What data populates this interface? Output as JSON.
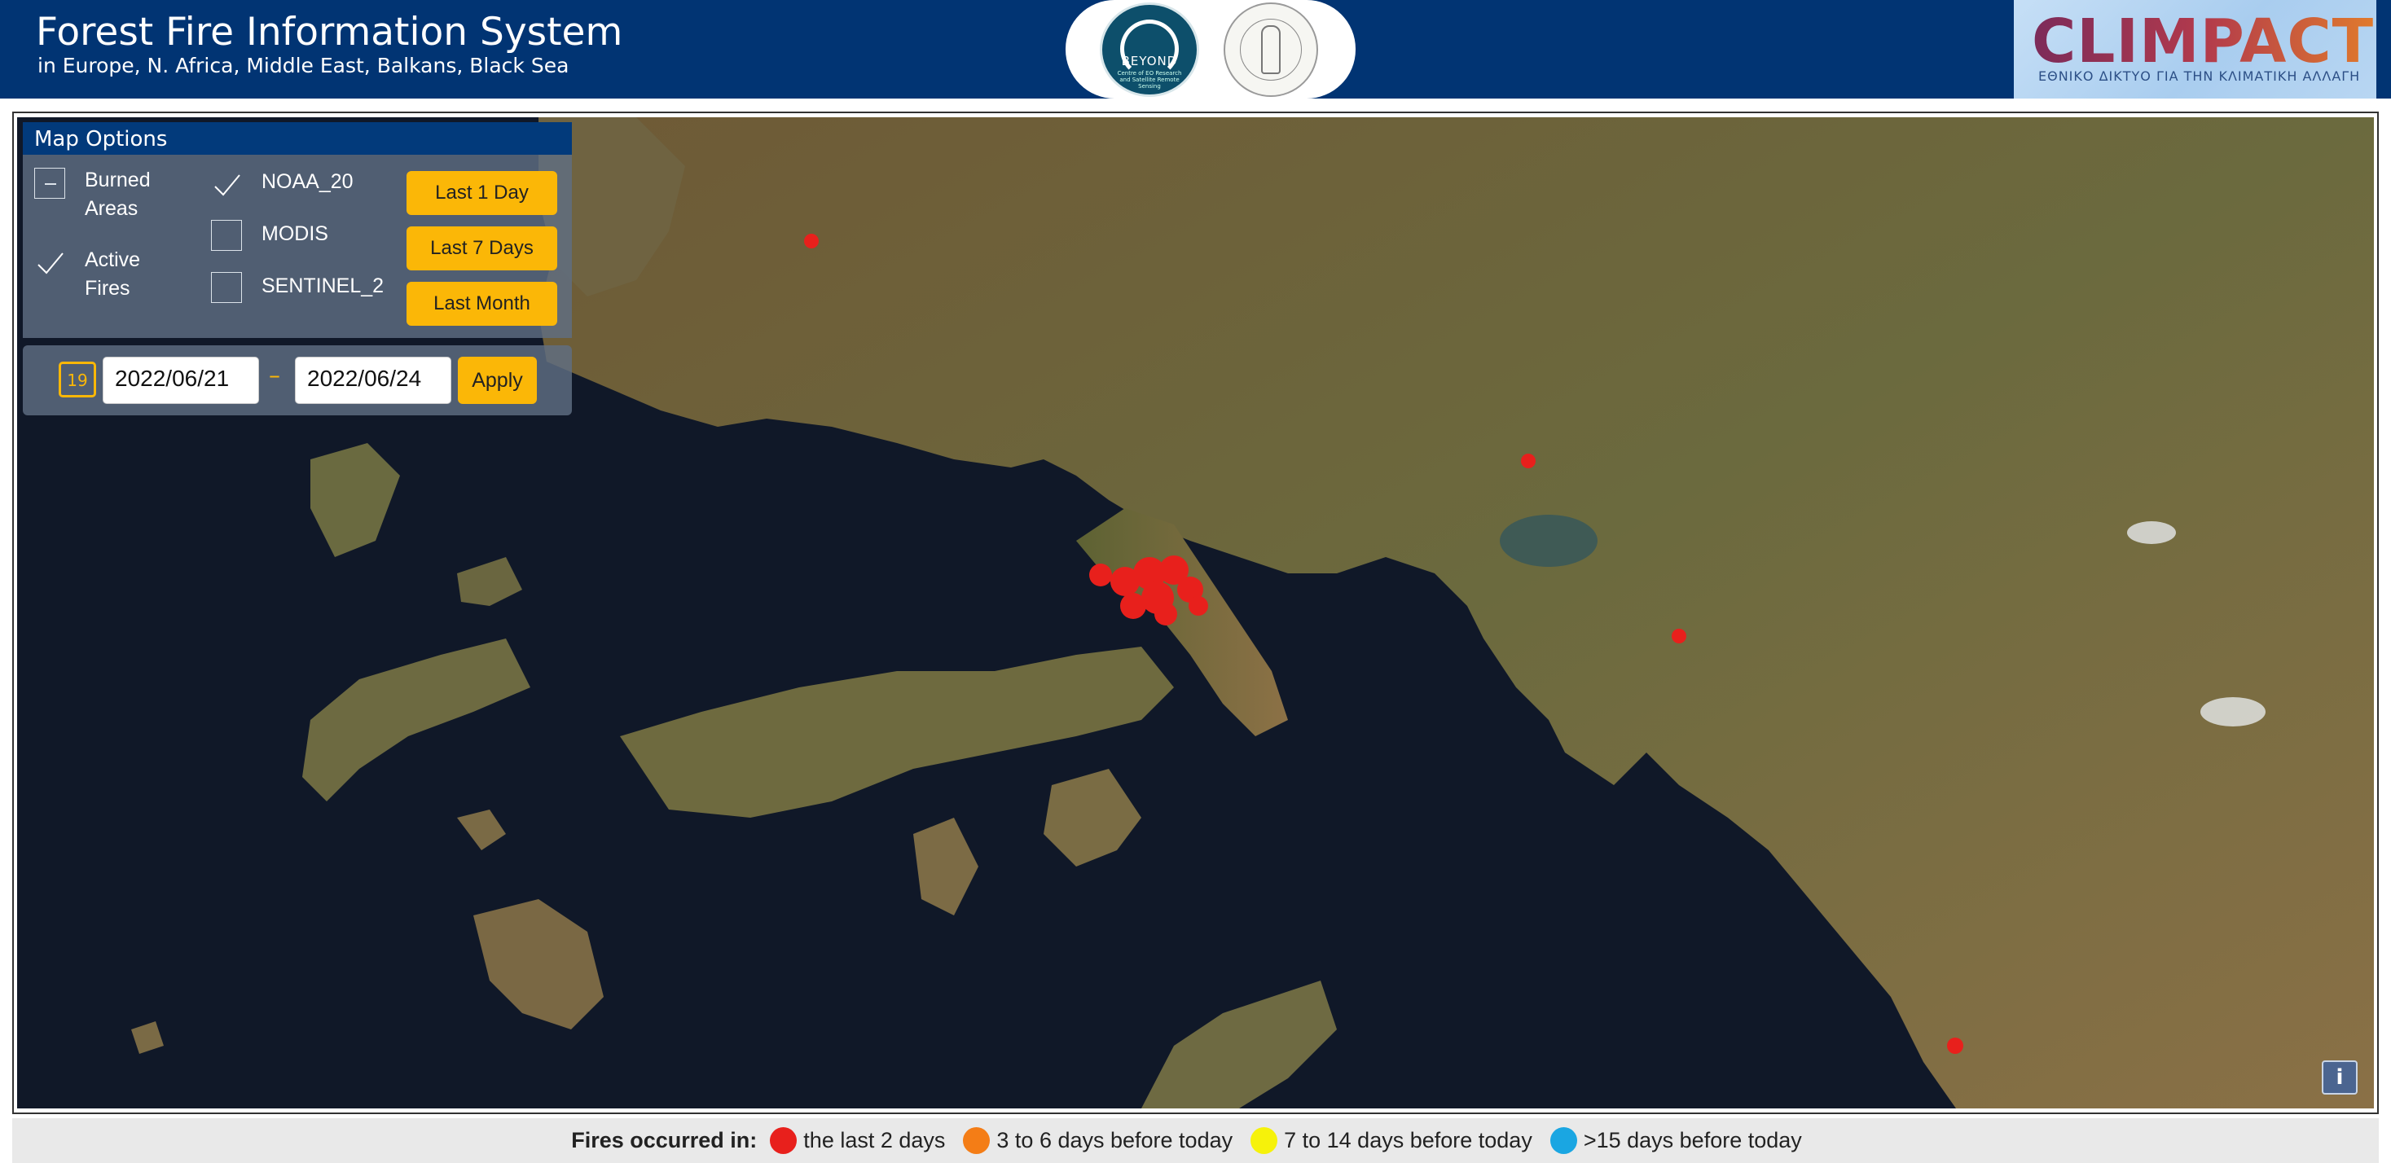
{
  "header": {
    "title": "Forest Fire Information System",
    "subtitle": "in Europe, N. Africa, Middle East, Balkans, Black Sea",
    "beyond_logo": {
      "name": "BEYOND",
      "tagline": "Centre of EO Research and Satellite Remote Sensing"
    },
    "climpact_logo": {
      "word": "CLIMPACT",
      "tagline": "ΕΘΝΙΚΟ ΔΙΚΤΥΟ ΓΙΑ ΤΗΝ ΚΛΙΜΑΤΙΚΗ ΑΛΛΑΓΗ"
    }
  },
  "map_options": {
    "title": "Map Options",
    "layers": [
      {
        "label_line1": "Burned",
        "label_line2": "Areas",
        "state": "partial"
      },
      {
        "label_line1": "Active",
        "label_line2": "Fires",
        "state": "checked"
      }
    ],
    "sources": [
      {
        "label": "NOAA_20",
        "checked": true
      },
      {
        "label": "MODIS",
        "checked": false
      },
      {
        "label": "SENTINEL_2",
        "checked": false
      }
    ],
    "time_buttons": [
      "Last 1 Day",
      "Last 7 Days",
      "Last Month"
    ]
  },
  "date_range": {
    "calendar_icon_label": "19",
    "start": "2022/06/21",
    "separator": "–",
    "end": "2022/06/24",
    "apply_label": "Apply"
  },
  "info_button": "i",
  "legend": {
    "title": "Fires occurred in:",
    "items": [
      {
        "label": "the last 2 days",
        "color": "#e8201c"
      },
      {
        "label": "3 to 6 days before today",
        "color": "#f47d16"
      },
      {
        "label": "7 to 14 days before today",
        "color": "#f6f20a"
      },
      {
        "label": ">15 days before today",
        "color": "#1aa6e2"
      }
    ]
  },
  "colors": {
    "header_bg": "#013473",
    "accent": "#fbb707",
    "sea": "#101828",
    "land": "#7a6a45",
    "fire_recent": "#e8201c"
  }
}
